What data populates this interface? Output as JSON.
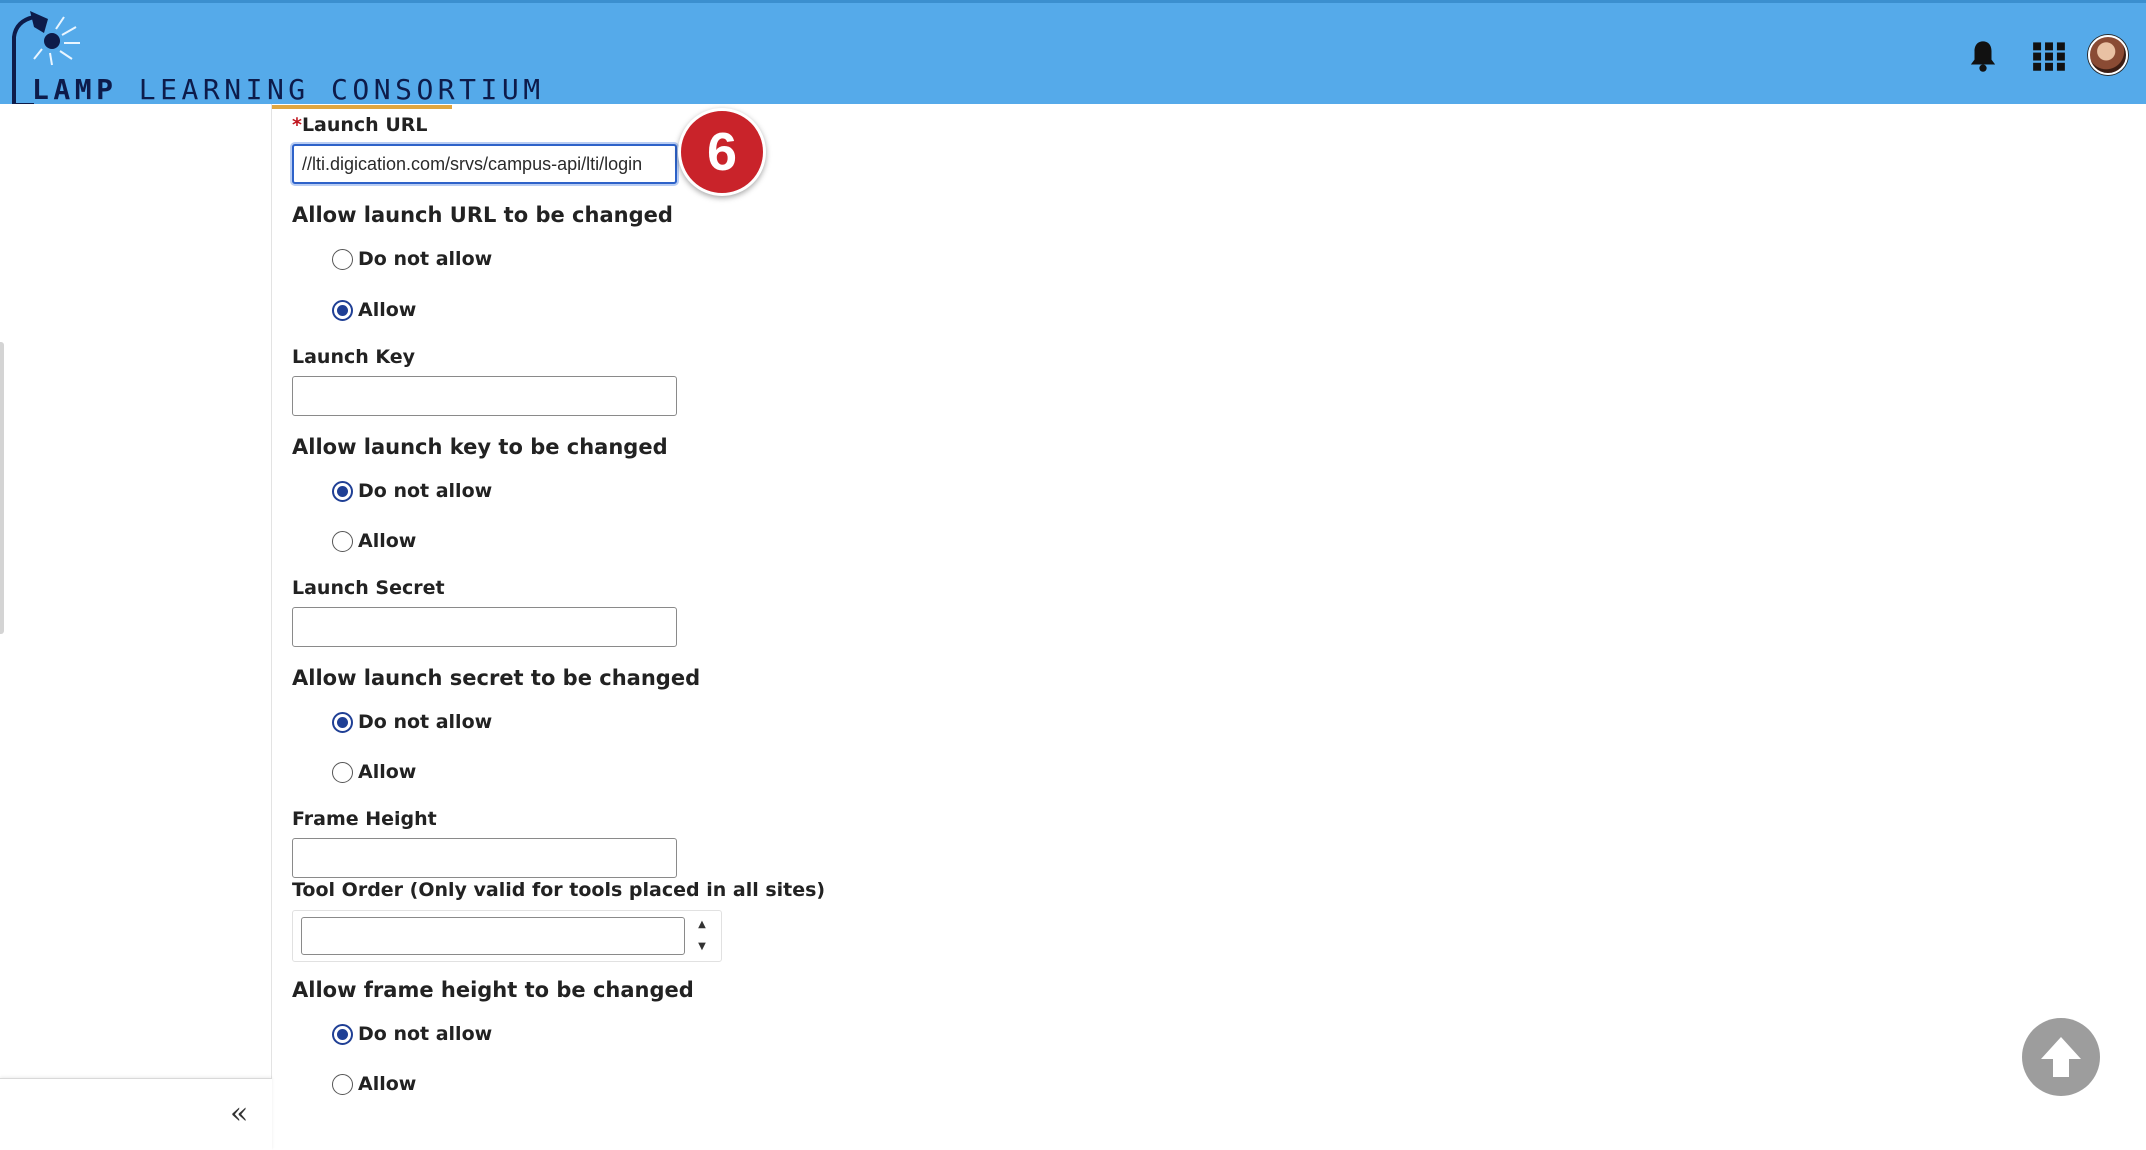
{
  "header": {
    "logo": {
      "word_bold": "LAMP",
      "word_rest": " LEARNING CONSORTIUM"
    },
    "icons": [
      "bell-icon",
      "apps-grid-icon",
      "user-avatar"
    ]
  },
  "sidebar": {
    "collapse_label": "«"
  },
  "form": {
    "launch_url": {
      "required_mark": "*",
      "label": "Launch URL",
      "value": "//lti.digication.com/srvs/campus-api/lti/login"
    },
    "allow_url_change": {
      "title": "Allow launch URL to be changed",
      "options": [
        {
          "label": "Do not allow",
          "checked": false
        },
        {
          "label": "Allow",
          "checked": true
        }
      ]
    },
    "launch_key": {
      "label": "Launch Key",
      "value": ""
    },
    "allow_key_change": {
      "title": "Allow launch key to be changed",
      "options": [
        {
          "label": "Do not allow",
          "checked": true
        },
        {
          "label": "Allow",
          "checked": false
        }
      ]
    },
    "launch_secret": {
      "label": "Launch Secret",
      "value": ""
    },
    "allow_secret_change": {
      "title": "Allow launch secret to be changed",
      "options": [
        {
          "label": "Do not allow",
          "checked": true
        },
        {
          "label": "Allow",
          "checked": false
        }
      ]
    },
    "frame_height": {
      "label": "Frame Height",
      "value": ""
    },
    "tool_order": {
      "label": "Tool Order (Only valid for tools placed in all sites)",
      "value": ""
    },
    "allow_frame_height_change": {
      "title": "Allow frame height to be changed",
      "options": [
        {
          "label": "Do not allow",
          "checked": true
        },
        {
          "label": "Allow",
          "checked": false
        }
      ]
    }
  },
  "callout": {
    "number": "6",
    "color": "#c9232a"
  },
  "colors": {
    "header": "#55aaea",
    "radio_checked": "#1f3f95",
    "accent_underline": "#e0a640"
  }
}
